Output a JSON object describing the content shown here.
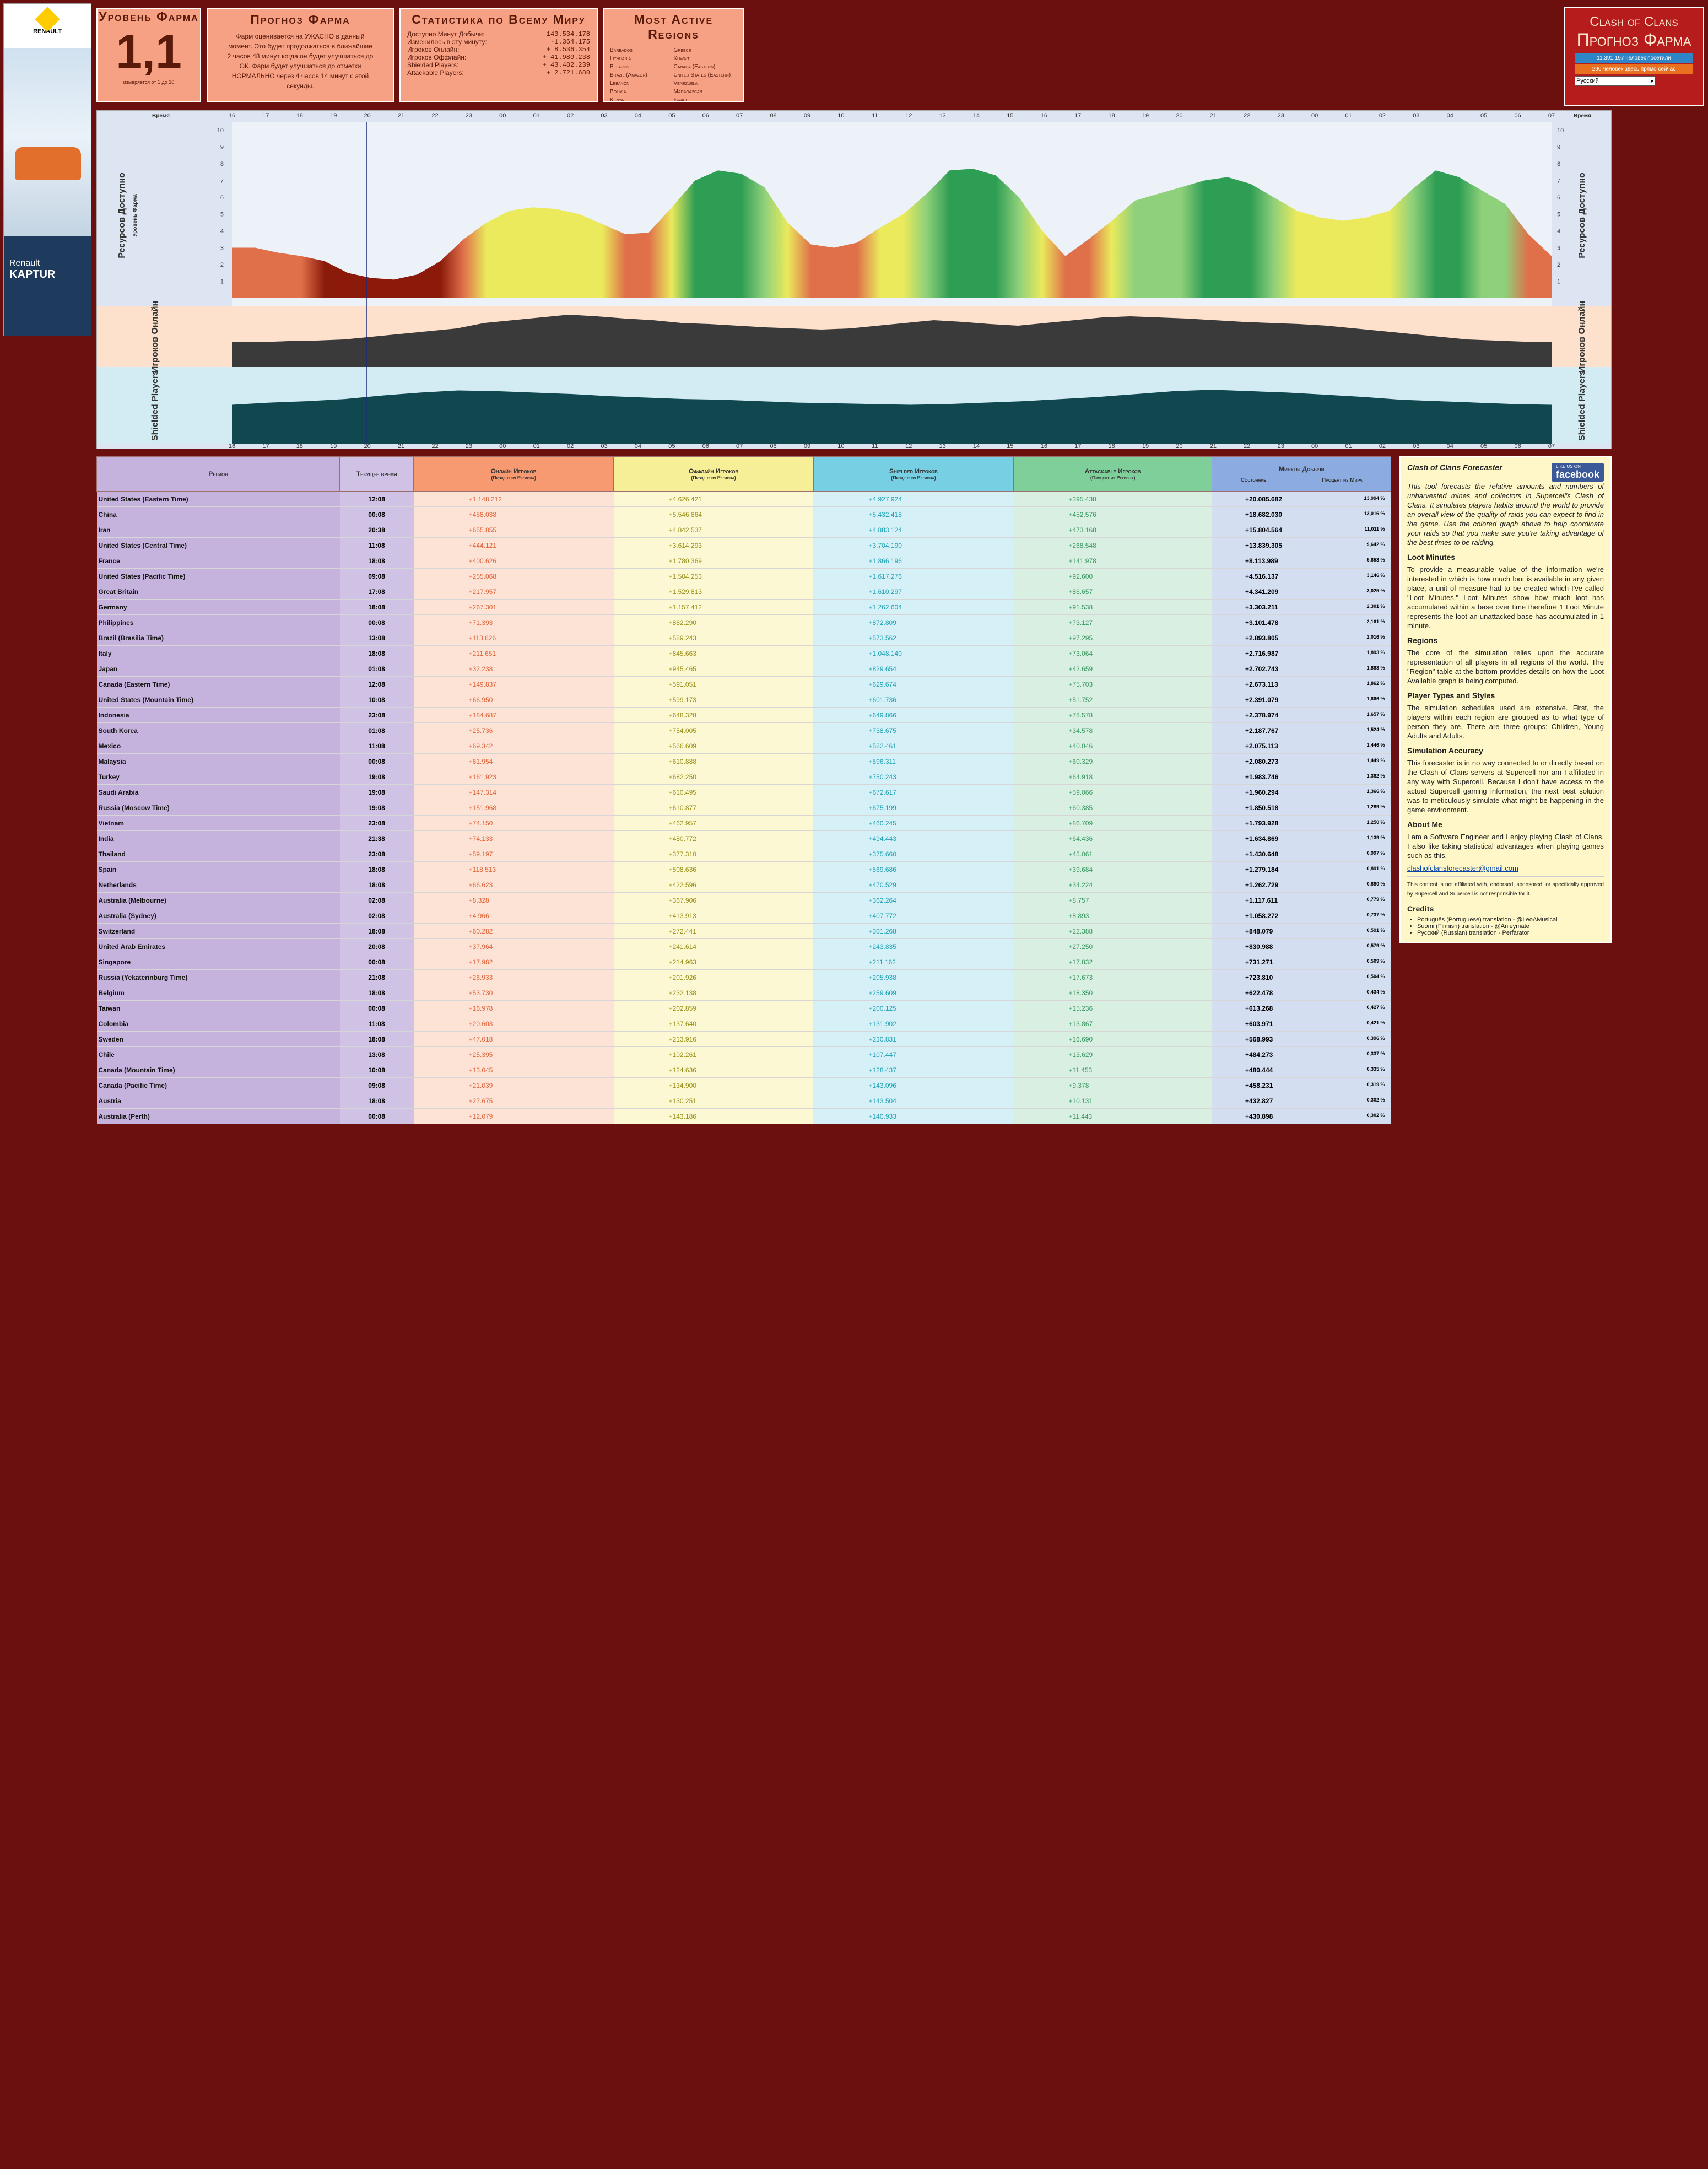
{
  "ad": {
    "brand": "RENAULT",
    "brand_sub": "Passion for life",
    "model_name": "Renault",
    "model": "KAPTUR"
  },
  "level": {
    "title": "Уровень Фарма",
    "value": "1,1",
    "note": "измеряется от 1 до 10"
  },
  "forecast": {
    "title": "Прогноз Фарма",
    "lines": [
      "Фарм оценивается на УЖАСНО в данный",
      "момент. Это будет продолжаться в ближайшие",
      "2 часов 48 минут когда он будет улучшаться до",
      "ОК. Фарм будет улучшаться до отметки",
      "НОРМАЛЬНО через 4 часов 14 минут с этой",
      "секунды."
    ]
  },
  "world": {
    "title": "Статистика по Всему Миру",
    "rows": [
      {
        "label": "Доступно Минут Добычи:",
        "value": "143.534.178"
      },
      {
        "label": "Изменилось в эту минуту:",
        "value": "-1.364.175"
      },
      {
        "label": "Игроков Онлайн:",
        "value": "+ 8.536.354"
      },
      {
        "label": "Игроков Оффлайн:",
        "value": "+ 41.980.238"
      },
      {
        "label": "Shielded Players:",
        "value": "+ 43.482.239"
      },
      {
        "label": "Attackable Players:",
        "value": "+ 2.721.680"
      }
    ]
  },
  "regions": {
    "title": "Most Active Regions",
    "col1": [
      "Barbados",
      "Lithuania",
      "Belarus",
      "Brazil (Amazon)",
      "Lebanon",
      "Bolivia",
      "Kenya"
    ],
    "col2": [
      "Greece",
      "Kuwait",
      "Canada (Eastern)",
      "United States (Eastern)",
      "Venezuela",
      "Madagascar",
      "Israel"
    ]
  },
  "coc": {
    "title1": "Clash of Clans",
    "title2": "Прогноз Фарма",
    "btn1": "11.391.197 человек посетили",
    "btn2": "290 человек здесь прямо сейчас",
    "lang": "Русский"
  },
  "chart": {
    "label_time": "Время",
    "label_res": "Ресурсов Доступно",
    "label_res_sub": "Уровень Фарма",
    "label_online": "Игроков Онлайн",
    "label_shield": "Shielded Players",
    "hours": [
      "16",
      "17",
      "18",
      "19",
      "20",
      "21",
      "22",
      "23",
      "00",
      "01",
      "02",
      "03",
      "04",
      "05",
      "06",
      "07",
      "08",
      "09",
      "10",
      "11",
      "12",
      "13",
      "14",
      "15",
      "16",
      "17",
      "18",
      "19",
      "20",
      "21",
      "22",
      "23",
      "00",
      "01",
      "02",
      "03",
      "04",
      "05",
      "06",
      "07"
    ],
    "yticks": [
      "1",
      "2",
      "3",
      "4",
      "5",
      "6",
      "7",
      "8",
      "9",
      "10"
    ],
    "levels": [
      3,
      3,
      2.7,
      2.5,
      2.2,
      1.5,
      1.2,
      1.1,
      1.4,
      2.2,
      3.5,
      4.5,
      5.2,
      5.4,
      5.3,
      5.0,
      4.4,
      3.8,
      3.9,
      5.4,
      7.0,
      7.6,
      7.4,
      6.6,
      4.5,
      3.2,
      3.0,
      3.3,
      4.2,
      5.0,
      6.2,
      7.6,
      7.7,
      7.3,
      6.0,
      4.0,
      2.5,
      3.5,
      4.6,
      5.8,
      6.2,
      6.6,
      7.0,
      7.2,
      6.8,
      6.0,
      5.2,
      4.8,
      4.6,
      4.8,
      5.2,
      6.5,
      7.6,
      7.2,
      6.4,
      5.6,
      3.8,
      2.5
    ],
    "online": [
      0.45,
      0.45,
      0.47,
      0.48,
      0.5,
      0.55,
      0.6,
      0.65,
      0.7,
      0.8,
      0.85,
      0.9,
      0.95,
      0.92,
      0.88,
      0.85,
      0.8,
      0.78,
      0.75,
      0.72,
      0.7,
      0.68,
      0.7,
      0.75,
      0.8,
      0.85,
      0.82,
      0.78,
      0.75,
      0.8,
      0.85,
      0.9,
      0.92,
      0.9,
      0.88,
      0.85,
      0.82,
      0.8,
      0.78,
      0.75,
      0.7,
      0.65,
      0.6,
      0.55,
      0.5,
      0.48,
      0.46,
      0.45
    ],
    "shield": [
      0.55,
      0.58,
      0.6,
      0.63,
      0.68,
      0.72,
      0.75,
      0.74,
      0.72,
      0.7,
      0.67,
      0.65,
      0.63,
      0.62,
      0.6,
      0.58,
      0.57,
      0.56,
      0.55,
      0.56,
      0.58,
      0.6,
      0.63,
      0.66,
      0.7,
      0.74,
      0.76,
      0.74,
      0.72,
      0.69,
      0.66,
      0.62,
      0.6,
      0.58,
      0.56,
      0.55
    ]
  },
  "table": {
    "headers": {
      "region": "Регион",
      "time": "Текущее время",
      "online": "Онлайн Игроков",
      "offline": "Оффлайн Игроков",
      "shield": "Shielded Игроков",
      "attack": "Attackable Игроков",
      "sub": "(Процент из Региона)",
      "loot": "Минуты Добычи",
      "loot_state": "Состояние",
      "loot_pct": "Процент из Мира"
    },
    "rows": [
      [
        "United States (Eastern Time)",
        "12:08",
        "+1.148.212",
        "+4.626.421",
        "+4.927.924",
        "+395.438",
        "+20.085.682",
        "13,994 %"
      ],
      [
        "China",
        "00:08",
        "+458.038",
        "+5.546.864",
        "+5.432.418",
        "+452.576",
        "+18.682.030",
        "13,016 %"
      ],
      [
        "Iran",
        "20:38",
        "+655.855",
        "+4.842.537",
        "+4.883.124",
        "+473.168",
        "+15.804.564",
        "11,011 %"
      ],
      [
        "United States (Central Time)",
        "11:08",
        "+444.121",
        "+3.614.293",
        "+3.704.190",
        "+268.548",
        "+13.839.305",
        "9,642 %"
      ],
      [
        "France",
        "18:08",
        "+400.626",
        "+1.780.369",
        "+1.866.196",
        "+141.978",
        "+8.113.989",
        "5,653 %"
      ],
      [
        "United States (Pacific Time)",
        "09:08",
        "+255.068",
        "+1.504.253",
        "+1.617.276",
        "+92.600",
        "+4.516.137",
        "3,146 %"
      ],
      [
        "Great Britain",
        "17:08",
        "+217.957",
        "+1.529.813",
        "+1.610.297",
        "+86.657",
        "+4.341.209",
        "3,025 %"
      ],
      [
        "Germany",
        "18:08",
        "+267.301",
        "+1.157.412",
        "+1.262.604",
        "+91.538",
        "+3.303.211",
        "2,301 %"
      ],
      [
        "Philippines",
        "00:08",
        "+71.393",
        "+882.290",
        "+872.809",
        "+73.127",
        "+3.101.478",
        "2,161 %"
      ],
      [
        "Brazil (Brasilia Time)",
        "13:08",
        "+113.626",
        "+589.243",
        "+573.562",
        "+97.295",
        "+2.893.805",
        "2,016 %"
      ],
      [
        "Italy",
        "18:08",
        "+211.651",
        "+845.663",
        "+1.048.140",
        "+73.064",
        "+2.716.987",
        "1,893 %"
      ],
      [
        "Japan",
        "01:08",
        "+32.238",
        "+945.465",
        "+829.654",
        "+42.659",
        "+2.702.743",
        "1,883 %"
      ],
      [
        "Canada (Eastern Time)",
        "12:08",
        "+149.837",
        "+591.051",
        "+629.674",
        "+75.703",
        "+2.673.113",
        "1,862 %"
      ],
      [
        "United States (Mountain Time)",
        "10:08",
        "+66.950",
        "+599.173",
        "+601.736",
        "+51.752",
        "+2.391.079",
        "1,666 %"
      ],
      [
        "Indonesia",
        "23:08",
        "+184.687",
        "+648.328",
        "+649.866",
        "+78.578",
        "+2.378.974",
        "1,657 %"
      ],
      [
        "South Korea",
        "01:08",
        "+25.736",
        "+754.005",
        "+738.675",
        "+34.578",
        "+2.187.767",
        "1,524 %"
      ],
      [
        "Mexico",
        "11:08",
        "+69.342",
        "+566.609",
        "+582.461",
        "+40.046",
        "+2.075.113",
        "1,446 %"
      ],
      [
        "Malaysia",
        "00:08",
        "+81.954",
        "+610.888",
        "+596.311",
        "+60.329",
        "+2.080.273",
        "1,449 %"
      ],
      [
        "Turkey",
        "19:08",
        "+161.923",
        "+682.250",
        "+750.243",
        "+64.918",
        "+1.983.746",
        "1,382 %"
      ],
      [
        "Saudi Arabia",
        "19:08",
        "+147.314",
        "+610.495",
        "+672.617",
        "+59.066",
        "+1.960.294",
        "1,366 %"
      ],
      [
        "Russia (Moscow Time)",
        "19:08",
        "+151.968",
        "+610.877",
        "+675.199",
        "+60.385",
        "+1.850.518",
        "1,289 %"
      ],
      [
        "Vietnam",
        "23:08",
        "+74.150",
        "+462.957",
        "+460.245",
        "+86.709",
        "+1.793.928",
        "1,250 %"
      ],
      [
        "India",
        "21:38",
        "+74.133",
        "+480.772",
        "+494.443",
        "+64.436",
        "+1.634.869",
        "1,139 %"
      ],
      [
        "Thailand",
        "23:08",
        "+59.197",
        "+377.310",
        "+375.660",
        "+45.061",
        "+1.430.648",
        "0,997 %"
      ],
      [
        "Spain",
        "18:08",
        "+118.513",
        "+508.636",
        "+569.686",
        "+39.684",
        "+1.279.184",
        "0,891 %"
      ],
      [
        "Netherlands",
        "18:08",
        "+66.623",
        "+422.596",
        "+470.529",
        "+34.224",
        "+1.262.729",
        "0,880 %"
      ],
      [
        "Australia (Melbourne)",
        "02:08",
        "+8.328",
        "+367.906",
        "+362.264",
        "+8.757",
        "+1.117.611",
        "0,779 %"
      ],
      [
        "Australia (Sydney)",
        "02:08",
        "+4.966",
        "+413.913",
        "+407.772",
        "+8.893",
        "+1.058.272",
        "0,737 %"
      ],
      [
        "Switzerland",
        "18:08",
        "+60.282",
        "+272.441",
        "+301.268",
        "+22.388",
        "+848.079",
        "0,591 %"
      ],
      [
        "United Arab Emirates",
        "20:08",
        "+37.964",
        "+241.614",
        "+243.835",
        "+27.250",
        "+830.988",
        "0,579 %"
      ],
      [
        "Singapore",
        "00:08",
        "+17.982",
        "+214.963",
        "+211.162",
        "+17.832",
        "+731.271",
        "0,509 %"
      ],
      [
        "Russia (Yekaterinburg Time)",
        "21:08",
        "+26.933",
        "+201.926",
        "+205.938",
        "+17.673",
        "+723.810",
        "0,504 %"
      ],
      [
        "Belgium",
        "18:08",
        "+53.730",
        "+232.138",
        "+259.609",
        "+18.350",
        "+622.478",
        "0,434 %"
      ],
      [
        "Taiwan",
        "00:08",
        "+16.978",
        "+202.859",
        "+200.125",
        "+15.236",
        "+613.268",
        "0,427 %"
      ],
      [
        "Colombia",
        "11:08",
        "+20.603",
        "+137.640",
        "+131.902",
        "+13.867",
        "+603.971",
        "0,421 %"
      ],
      [
        "Sweden",
        "18:08",
        "+47.018",
        "+213.916",
        "+230.831",
        "+16.690",
        "+568.993",
        "0,396 %"
      ],
      [
        "Chile",
        "13:08",
        "+25.395",
        "+102.261",
        "+107.447",
        "+13.629",
        "+484.273",
        "0,337 %"
      ],
      [
        "Canada (Mountain Time)",
        "10:08",
        "+13.045",
        "+124.636",
        "+128.437",
        "+11.453",
        "+480.444",
        "0,335 %"
      ],
      [
        "Canada (Pacific Time)",
        "09:08",
        "+21.039",
        "+134.900",
        "+143.096",
        "+9.378",
        "+458.231",
        "0,319 %"
      ],
      [
        "Austria",
        "18:08",
        "+27.675",
        "+130.251",
        "+143.504",
        "+10.131",
        "+432.827",
        "0,302 %"
      ],
      [
        "Australia (Perth)",
        "00:08",
        "+12.079",
        "+143.186",
        "+140.933",
        "+11.443",
        "+430.898",
        "0,302 %"
      ]
    ]
  },
  "side": {
    "h1": "Clash of Clans Forecaster",
    "fb": "facebook",
    "fb_like": "LIKE US ON",
    "p1": "This tool forecasts the relative amounts and numbers of unharvested mines and collectors in Supercell's Clash of Clans. It simulates players habits around the world to provide an overall view of the quality of raids you can expect to find in the game. Use the colored graph above to help coordinate your raids so that you make sure you're taking advantage of the best times to be raiding.",
    "h2": "Loot Minutes",
    "p2": "To provide a measurable value of the information we're interested in which is how much loot is available in any given place, a unit of measure had to be created which I've called \"Loot Minutes.\" Loot Minutes show how much loot has accumulated within a base over time therefore 1 Loot Minute represents the loot an unattacked base has accumulated in 1 minute.",
    "h3": "Regions",
    "p3": "The core of the simulation relies upon the accurate representation of all players in all regions of the world. The \"Region\" table at the bottom provides details on how the Loot Available graph is being computed.",
    "h4": "Player Types and Styles",
    "p4": "The simulation schedules used are extensive. First, the players within each region are grouped as to what type of person they are. There are three groups: Children, Young Adults and Adults.",
    "h5": "Simulation Accuracy",
    "p5": "This forecaster is in no way connected to or directly based on the Clash of Clans servers at Supercell nor am I affiliated in any way with Supercell. Because I don't have access to the actual Supercell gaming information, the next best solution was to meticulously simulate what might be happening in the game environment.",
    "h6": "About Me",
    "p6": "I am a Software Engineer and I enjoy playing Clash of Clans. I also like taking statistical advantages when playing games such as this.",
    "email": "clashofclansforecaster@gmail.com",
    "h7": "Credits",
    "credits": [
      "Português (Portuguese) translation - @LeoAMusical",
      "Suomi (Finnish) translation - @Anleymate",
      "Русский (Russian) translation - Perfarator"
    ],
    "disclaimer": "This content is not affiliated with, endorsed, sponsored, or specifically approved by Supercell and Supercell is not responsible for it."
  },
  "colors": {
    "bg": "#6b0f0f",
    "panel": "#f7a184"
  }
}
